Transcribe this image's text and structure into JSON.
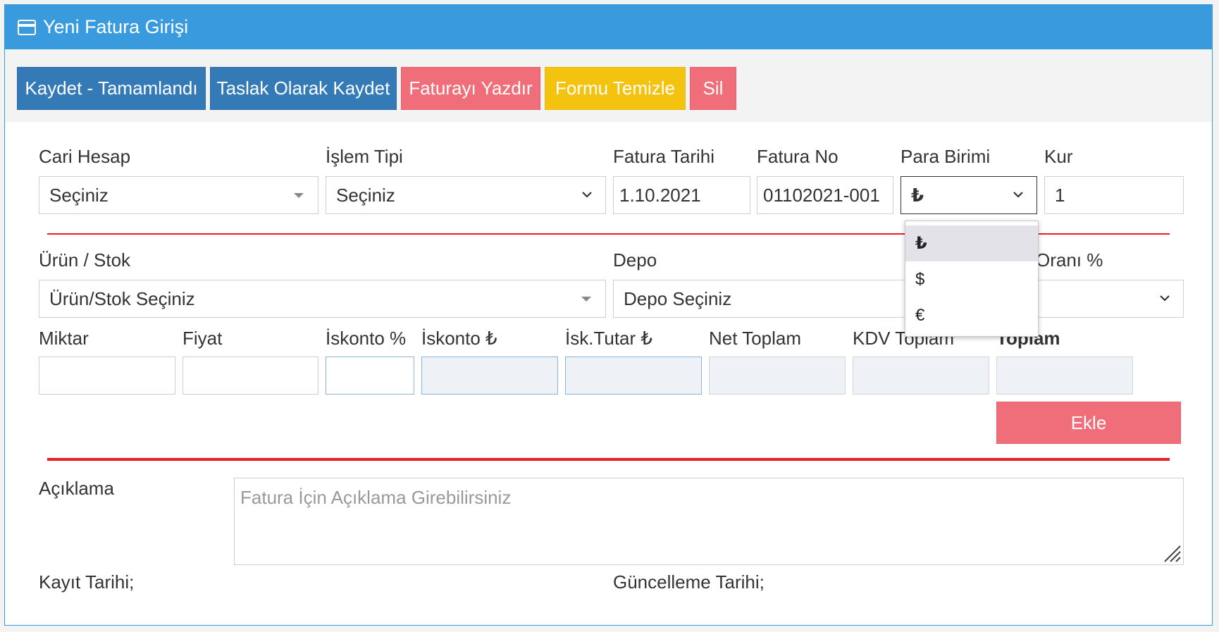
{
  "header": {
    "title": "Yeni Fatura Girişi",
    "icon": "credit-card-icon"
  },
  "toolbar": {
    "save_complete": "Kaydet - Tamamlandı",
    "save_draft": "Taslak Olarak Kaydet",
    "print": "Faturayı Yazdır",
    "clear": "Formu Temizle",
    "delete": "Sil"
  },
  "form": {
    "cari_hesap": {
      "label": "Cari Hesap",
      "value": "Seçiniz"
    },
    "islem_tipi": {
      "label": "İşlem Tipi",
      "value": "Seçiniz"
    },
    "fatura_tarihi": {
      "label": "Fatura Tarihi",
      "value": "1.10.2021"
    },
    "fatura_no": {
      "label": "Fatura No",
      "value": "01102021-001"
    },
    "para_birimi": {
      "label": "Para Birimi",
      "value": "₺",
      "options": [
        "₺",
        "$",
        "€"
      ]
    },
    "kur": {
      "label": "Kur",
      "value": "1"
    },
    "urun_stok": {
      "label": "Ürün / Stok",
      "value": "Ürün/Stok Seçiniz"
    },
    "depo": {
      "label": "Depo",
      "value": "Depo Seçiniz"
    },
    "kdv_orani": {
      "label": "Oranı %",
      "value": ""
    },
    "miktar": {
      "label": "Miktar",
      "value": ""
    },
    "fiyat": {
      "label": "Fiyat",
      "value": ""
    },
    "iskonto_yuzde": {
      "label": "İskonto %",
      "value": ""
    },
    "iskonto_tl": {
      "label": "İskonto ₺",
      "value": ""
    },
    "isk_tutar": {
      "label": "İsk.Tutar ₺",
      "value": ""
    },
    "net_toplam": {
      "label": "Net Toplam",
      "value": ""
    },
    "kdv_toplam": {
      "label": "KDV Toplam",
      "value": ""
    },
    "toplam": {
      "label": "Toplam",
      "value": ""
    },
    "ekle": "Ekle",
    "aciklama": {
      "label": "Açıklama",
      "placeholder": "Fatura İçin Açıklama Girebilirsiniz"
    },
    "kayit_tarihi": "Kayıt Tarihi;",
    "guncelleme_tarihi": "Güncelleme Tarihi;"
  },
  "colors": {
    "header": "#3a9ade",
    "primary": "#337ab7",
    "danger": "#ef6e79",
    "warning": "#f4c30f",
    "divider": "#ee1c25"
  }
}
